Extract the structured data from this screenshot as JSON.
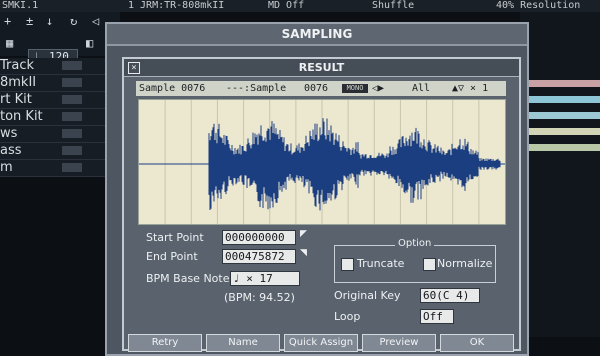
{
  "top_bar": {
    "left_text": "SMKI.1",
    "song_text": "1 JRM:TR-808mkII",
    "mid_text": "MD Off",
    "shuffle_text": "Shuffle",
    "right_text": "40% Resolution"
  },
  "toolbar": {
    "tempo": "120"
  },
  "tracks": [
    {
      "label": "Track"
    },
    {
      "label": "8mkII"
    },
    {
      "label": "rt Kit"
    },
    {
      "label": "ton Kit"
    },
    {
      "label": "ws"
    },
    {
      "label": "ass"
    },
    {
      "label": "m"
    }
  ],
  "sampling_window": {
    "title": "SAMPLING"
  },
  "result_dialog": {
    "title": "RESULT",
    "sample_bar": {
      "sample_label": "Sample 0076",
      "sample_name": "---:Sample",
      "sample_num": "0076",
      "mono": "MONO",
      "mode": "All",
      "pan": "▲▽ × 1"
    },
    "start_point": {
      "label": "Start Point",
      "value": "000000000"
    },
    "end_point": {
      "label": "End Point",
      "value": "000475872"
    },
    "bpm_base_note": {
      "label": "BPM Base Note",
      "value": "♩ ×  17",
      "bpm": "(BPM: 94.52)"
    },
    "option": {
      "title": "Option",
      "truncate": "Truncate",
      "normalize": "Normalize"
    },
    "original_key": {
      "label": "Original Key",
      "value": "60(C 4)"
    },
    "loop": {
      "label": "Loop",
      "value": "Off"
    },
    "buttons": [
      {
        "label": "Retry"
      },
      {
        "label": "Name"
      },
      {
        "label": "Quick Assign"
      },
      {
        "label": "Preview"
      },
      {
        "label": "OK"
      }
    ]
  },
  "colors": {
    "waveform": "#1a3e80",
    "wave_bg": "#ece7cf",
    "dialog_bg": "#59626d"
  }
}
